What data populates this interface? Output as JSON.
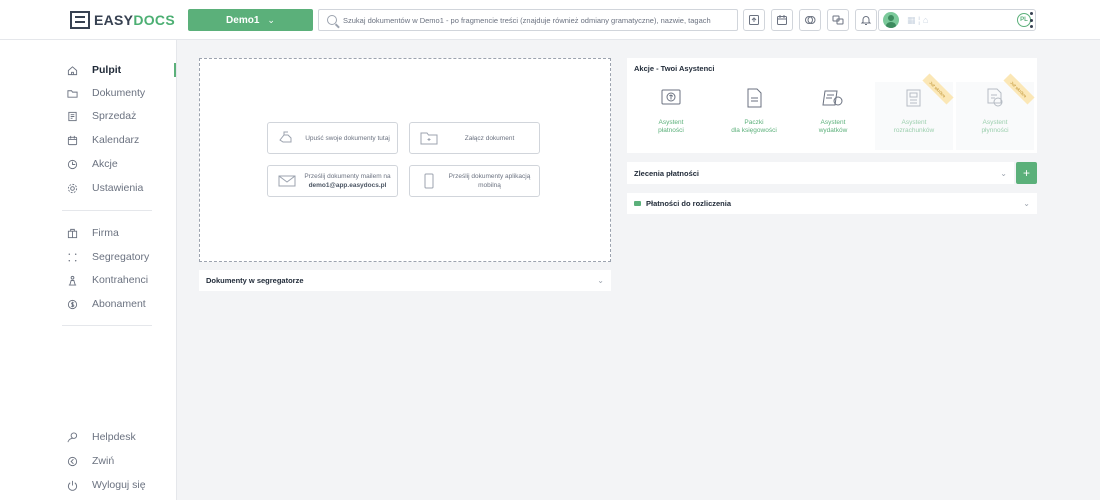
{
  "header": {
    "logo_prefix": "EASY",
    "logo_accent": "DOCS",
    "workspace": "Demo1",
    "workspace_chevron": "⌄",
    "search_placeholder": "Szukaj dokumentów w Demo1 - po fragmencie treści (znajduje również odmiany gramatyczne), nazwie, tagach",
    "icons": [
      "upload-doc-icon",
      "calendar-icon",
      "currency-icon",
      "chat-icon",
      "bell-icon"
    ],
    "user_faint": "▦  ¦ ⌂",
    "lang": "PL"
  },
  "sidebar": {
    "items_top": [
      {
        "label": "Pulpit",
        "icon": "home-icon",
        "active": true
      },
      {
        "label": "Dokumenty",
        "icon": "folder-icon"
      },
      {
        "label": "Sprzedaż",
        "icon": "invoice-icon"
      },
      {
        "label": "Kalendarz",
        "icon": "calendar-icon"
      },
      {
        "label": "Akcje",
        "icon": "clock-icon"
      },
      {
        "label": "Ustawienia",
        "icon": "gear-icon"
      }
    ],
    "items_mid": [
      {
        "label": "Firma",
        "icon": "building-icon"
      },
      {
        "label": "Segregatory",
        "icon": "grid-icon"
      },
      {
        "label": "Kontrahenci",
        "icon": "contractor-icon"
      },
      {
        "label": "Abonament",
        "icon": "coin-icon"
      }
    ],
    "items_bottom": [
      {
        "label": "Helpdesk",
        "icon": "helpdesk-icon"
      },
      {
        "label": "Zwiń",
        "icon": "collapse-icon"
      },
      {
        "label": "Wyloguj się",
        "icon": "power-icon"
      }
    ]
  },
  "upload": {
    "drop": "Upuść swoje dokumenty tutaj",
    "attach": "Załącz dokument",
    "email_line1": "Prześlij dokumenty mailem na",
    "email_address": "demo1@app.easydocs.pl",
    "mobile": "Prześlij dokumenty aplikacją mobilną"
  },
  "binders_panel": {
    "title": "Dokumenty w segregatorze",
    "chevron": "⌄"
  },
  "assistants": {
    "title": "Akcje - Twoi Asystenci",
    "tiles": [
      {
        "line1": "Asystent",
        "line2": "płatności",
        "icon": "payment-assistant-icon",
        "disabled": false
      },
      {
        "line1": "Paczki",
        "line2": "dla księgowości",
        "icon": "package-icon",
        "disabled": false
      },
      {
        "line1": "Asystent",
        "line2": "wydatków",
        "icon": "expenses-assistant-icon",
        "disabled": false
      },
      {
        "line1": "Asystent",
        "line2": "rozrachunków",
        "icon": "settlements-assistant-icon",
        "disabled": true,
        "ribbon": "Już wkrótce"
      },
      {
        "line1": "Asystent",
        "line2": "płynności",
        "icon": "liquidity-assistant-icon",
        "disabled": true,
        "ribbon": "Już wkrótce"
      }
    ]
  },
  "payment_orders": {
    "title": "Zlecenia płatności",
    "chevron": "⌄",
    "add": "+"
  },
  "settlements": {
    "title": "Płatności do rozliczenia",
    "chevron": "⌄"
  },
  "colors": {
    "accent": "#5bb07a",
    "text_dark": "#1f2937",
    "muted": "#6b7280"
  }
}
